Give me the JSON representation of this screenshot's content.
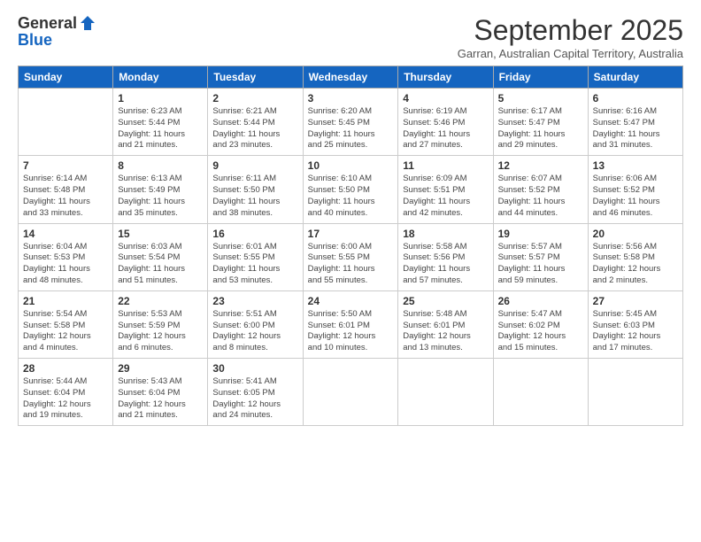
{
  "logo": {
    "general": "General",
    "blue": "Blue"
  },
  "title": "September 2025",
  "subtitle": "Garran, Australian Capital Territory, Australia",
  "days_of_week": [
    "Sunday",
    "Monday",
    "Tuesday",
    "Wednesday",
    "Thursday",
    "Friday",
    "Saturday"
  ],
  "weeks": [
    [
      {
        "day": "",
        "info": ""
      },
      {
        "day": "1",
        "info": "Sunrise: 6:23 AM\nSunset: 5:44 PM\nDaylight: 11 hours\nand 21 minutes."
      },
      {
        "day": "2",
        "info": "Sunrise: 6:21 AM\nSunset: 5:44 PM\nDaylight: 11 hours\nand 23 minutes."
      },
      {
        "day": "3",
        "info": "Sunrise: 6:20 AM\nSunset: 5:45 PM\nDaylight: 11 hours\nand 25 minutes."
      },
      {
        "day": "4",
        "info": "Sunrise: 6:19 AM\nSunset: 5:46 PM\nDaylight: 11 hours\nand 27 minutes."
      },
      {
        "day": "5",
        "info": "Sunrise: 6:17 AM\nSunset: 5:47 PM\nDaylight: 11 hours\nand 29 minutes."
      },
      {
        "day": "6",
        "info": "Sunrise: 6:16 AM\nSunset: 5:47 PM\nDaylight: 11 hours\nand 31 minutes."
      }
    ],
    [
      {
        "day": "7",
        "info": "Sunrise: 6:14 AM\nSunset: 5:48 PM\nDaylight: 11 hours\nand 33 minutes."
      },
      {
        "day": "8",
        "info": "Sunrise: 6:13 AM\nSunset: 5:49 PM\nDaylight: 11 hours\nand 35 minutes."
      },
      {
        "day": "9",
        "info": "Sunrise: 6:11 AM\nSunset: 5:50 PM\nDaylight: 11 hours\nand 38 minutes."
      },
      {
        "day": "10",
        "info": "Sunrise: 6:10 AM\nSunset: 5:50 PM\nDaylight: 11 hours\nand 40 minutes."
      },
      {
        "day": "11",
        "info": "Sunrise: 6:09 AM\nSunset: 5:51 PM\nDaylight: 11 hours\nand 42 minutes."
      },
      {
        "day": "12",
        "info": "Sunrise: 6:07 AM\nSunset: 5:52 PM\nDaylight: 11 hours\nand 44 minutes."
      },
      {
        "day": "13",
        "info": "Sunrise: 6:06 AM\nSunset: 5:52 PM\nDaylight: 11 hours\nand 46 minutes."
      }
    ],
    [
      {
        "day": "14",
        "info": "Sunrise: 6:04 AM\nSunset: 5:53 PM\nDaylight: 11 hours\nand 48 minutes."
      },
      {
        "day": "15",
        "info": "Sunrise: 6:03 AM\nSunset: 5:54 PM\nDaylight: 11 hours\nand 51 minutes."
      },
      {
        "day": "16",
        "info": "Sunrise: 6:01 AM\nSunset: 5:55 PM\nDaylight: 11 hours\nand 53 minutes."
      },
      {
        "day": "17",
        "info": "Sunrise: 6:00 AM\nSunset: 5:55 PM\nDaylight: 11 hours\nand 55 minutes."
      },
      {
        "day": "18",
        "info": "Sunrise: 5:58 AM\nSunset: 5:56 PM\nDaylight: 11 hours\nand 57 minutes."
      },
      {
        "day": "19",
        "info": "Sunrise: 5:57 AM\nSunset: 5:57 PM\nDaylight: 11 hours\nand 59 minutes."
      },
      {
        "day": "20",
        "info": "Sunrise: 5:56 AM\nSunset: 5:58 PM\nDaylight: 12 hours\nand 2 minutes."
      }
    ],
    [
      {
        "day": "21",
        "info": "Sunrise: 5:54 AM\nSunset: 5:58 PM\nDaylight: 12 hours\nand 4 minutes."
      },
      {
        "day": "22",
        "info": "Sunrise: 5:53 AM\nSunset: 5:59 PM\nDaylight: 12 hours\nand 6 minutes."
      },
      {
        "day": "23",
        "info": "Sunrise: 5:51 AM\nSunset: 6:00 PM\nDaylight: 12 hours\nand 8 minutes."
      },
      {
        "day": "24",
        "info": "Sunrise: 5:50 AM\nSunset: 6:01 PM\nDaylight: 12 hours\nand 10 minutes."
      },
      {
        "day": "25",
        "info": "Sunrise: 5:48 AM\nSunset: 6:01 PM\nDaylight: 12 hours\nand 13 minutes."
      },
      {
        "day": "26",
        "info": "Sunrise: 5:47 AM\nSunset: 6:02 PM\nDaylight: 12 hours\nand 15 minutes."
      },
      {
        "day": "27",
        "info": "Sunrise: 5:45 AM\nSunset: 6:03 PM\nDaylight: 12 hours\nand 17 minutes."
      }
    ],
    [
      {
        "day": "28",
        "info": "Sunrise: 5:44 AM\nSunset: 6:04 PM\nDaylight: 12 hours\nand 19 minutes."
      },
      {
        "day": "29",
        "info": "Sunrise: 5:43 AM\nSunset: 6:04 PM\nDaylight: 12 hours\nand 21 minutes."
      },
      {
        "day": "30",
        "info": "Sunrise: 5:41 AM\nSunset: 6:05 PM\nDaylight: 12 hours\nand 24 minutes."
      },
      {
        "day": "",
        "info": ""
      },
      {
        "day": "",
        "info": ""
      },
      {
        "day": "",
        "info": ""
      },
      {
        "day": "",
        "info": ""
      }
    ]
  ]
}
